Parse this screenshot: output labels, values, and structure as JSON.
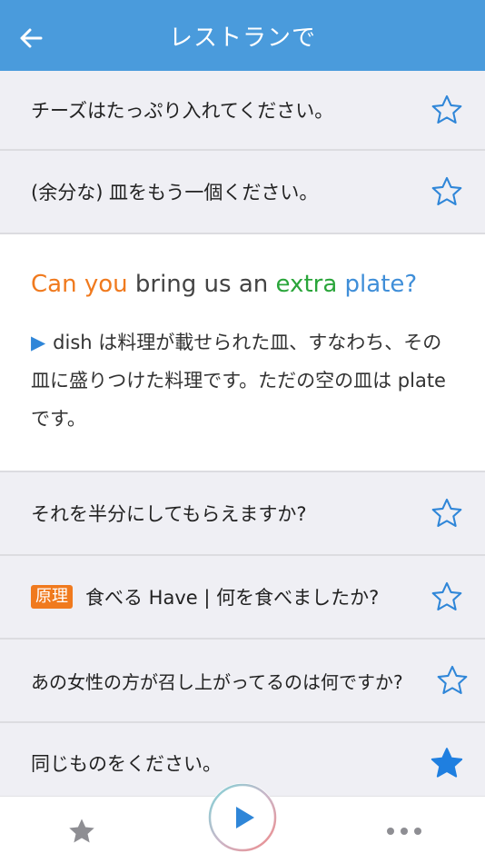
{
  "header": {
    "title": "レストランで",
    "back_icon": "arrow-left-icon"
  },
  "rows_top": [
    {
      "text": "チーズはたっぷり入れてください。",
      "starred": false
    },
    {
      "text": "(余分な) 皿をもう一個ください。",
      "starred": false
    }
  ],
  "detail": {
    "english_words": [
      {
        "text": "Can you",
        "color": "orange"
      },
      {
        "text": " bring us an ",
        "color": "gray"
      },
      {
        "text": "extra",
        "color": "green"
      },
      {
        "text": " plate?",
        "color": "blue"
      }
    ],
    "note_marker": "▶",
    "note": "dish は料理が載せられた皿、すなわち、その皿に盛りつけた料理です。ただの空の皿は plate です。"
  },
  "rows_bottom": [
    {
      "text": "それを半分にしてもらえますか?",
      "starred": false
    },
    {
      "badge": "原理",
      "text": "食べる Have | 何を食べましたか?",
      "starred": false
    },
    {
      "text": "あの女性の方が召し上がってるのは何ですか?",
      "starred": false
    },
    {
      "text": "同じものをください。",
      "starred": true
    }
  ],
  "colors": {
    "header": "#4a9bdc",
    "orange": "#f07a1e",
    "green": "#2aa53a",
    "blue": "#3f8ed8",
    "star": "#2f86d8"
  },
  "footer": {
    "favorites_icon": "star-filled-icon",
    "play_icon": "play-icon",
    "more_icon": "more-dots-icon"
  }
}
